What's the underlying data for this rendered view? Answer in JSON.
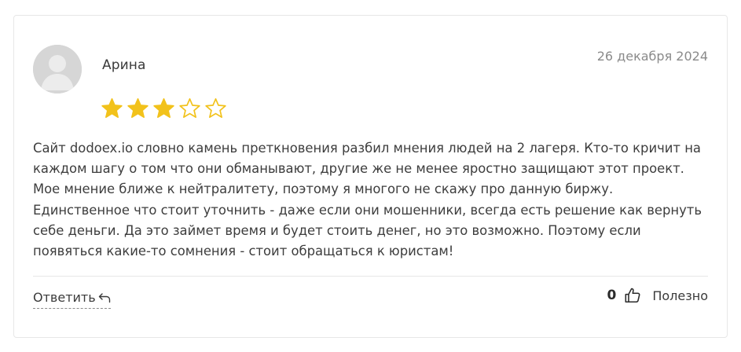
{
  "review": {
    "author": "Арина",
    "date": "26 декабря 2024",
    "rating": 3,
    "rating_max": 5,
    "star_color": "#f2c21b",
    "text": "Сайт dodoex.io словно камень преткновения разбил мнения людей на 2 лагеря. Кто-то кричит на каждом шагу о том что они обманывают, другие же не менее яростно защищают этот проект. Мое мнение ближе к нейтралитету, поэтому я многого не скажу про данную биржу. Единственное что стоит уточнить - даже если они мошенники, всегда есть решение как вернуть себе деньги. Да это займет время и будет стоить денег, но это возможно. Поэтому если появяться какие-то сомнения - стоит обращаться к юристам!"
  },
  "actions": {
    "reply_label": "Ответить",
    "reply_icon": "reply-arrow-icon",
    "likes_count": "0",
    "like_icon": "thumbs-up-icon",
    "helpful_label": "Полезно"
  }
}
